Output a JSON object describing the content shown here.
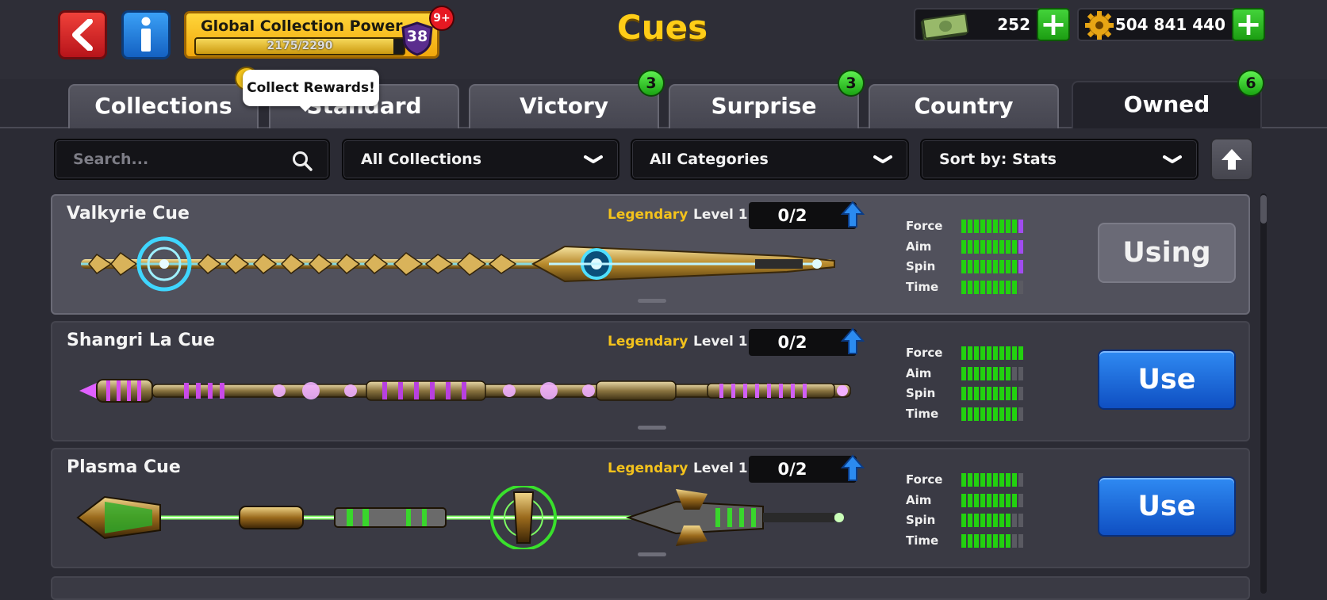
{
  "header": {
    "title": "Cues",
    "collection_power": {
      "label": "Global Collection Power",
      "progress_text": "2175/2290",
      "progress": 0.95,
      "level": "38",
      "notification_badge": "9+"
    },
    "tooltip": "Collect Rewards!",
    "cash": {
      "value": "252",
      "icon": "cash-icon"
    },
    "coins": {
      "value": "504 841 440",
      "icon": "coin-icon"
    }
  },
  "tabs": [
    {
      "label": "Collections",
      "badge": ""
    },
    {
      "label": "Standard",
      "badge": ""
    },
    {
      "label": "Victory",
      "badge": "3"
    },
    {
      "label": "Surprise",
      "badge": "3"
    },
    {
      "label": "Country",
      "badge": ""
    },
    {
      "label": "Owned",
      "badge": "6",
      "active": true
    }
  ],
  "filters": {
    "search_placeholder": "Search...",
    "collections": "All Collections",
    "categories": "All Categories",
    "sort": "Sort by: Stats"
  },
  "cues": [
    {
      "name": "Valkyrie Cue",
      "rarity": "Legendary",
      "level": "Level 1",
      "progress": "0/2",
      "action": "Using",
      "stats": [
        {
          "label": "Force",
          "green": 9,
          "purple": 1
        },
        {
          "label": "Aim",
          "green": 9,
          "purple": 1
        },
        {
          "label": "Spin",
          "green": 9,
          "purple": 1
        },
        {
          "label": "Time",
          "green": 9,
          "purple": 0
        }
      ]
    },
    {
      "name": "Shangri La Cue",
      "rarity": "Legendary",
      "level": "Level 1",
      "progress": "0/2",
      "action": "Use",
      "stats": [
        {
          "label": "Force",
          "green": 10,
          "purple": 0
        },
        {
          "label": "Aim",
          "green": 8,
          "purple": 0
        },
        {
          "label": "Spin",
          "green": 9,
          "purple": 0
        },
        {
          "label": "Time",
          "green": 9,
          "purple": 0
        }
      ]
    },
    {
      "name": "Plasma Cue",
      "rarity": "Legendary",
      "level": "Level 1",
      "progress": "0/2",
      "action": "Use",
      "stats": [
        {
          "label": "Force",
          "green": 9,
          "purple": 0
        },
        {
          "label": "Aim",
          "green": 9,
          "purple": 0
        },
        {
          "label": "Spin",
          "green": 8,
          "purple": 0
        },
        {
          "label": "Time",
          "green": 8,
          "purple": 0
        }
      ]
    }
  ],
  "colors": {
    "title": "#ffcd17",
    "legendary": "#f3c21c",
    "stat_green": "#22d10f",
    "stat_purple": "#a14cf0",
    "use_button": "#1f6fe0"
  }
}
